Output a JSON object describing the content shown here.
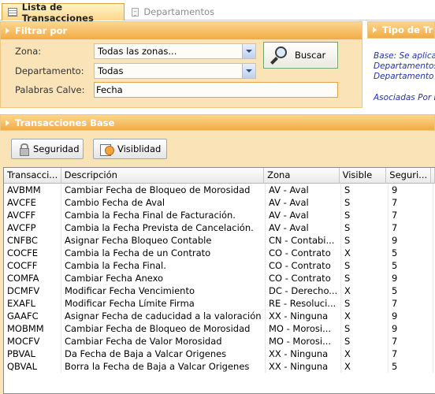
{
  "tabs": [
    {
      "label": "Lista de Transacciones",
      "active": true
    },
    {
      "label": "Departamentos",
      "active": false
    }
  ],
  "filter": {
    "title": "Filtrar por",
    "zona_label": "Zona:",
    "zona_value": "Todas las zonas...",
    "departamento_label": "Departamento:",
    "departamento_value": "Todas",
    "palabras_label": "Palabras Calve:",
    "palabras_value": "Fecha",
    "search_button": "Buscar"
  },
  "tipo": {
    "title": "Tipo de Tr",
    "lines": [
      "Base: Se aplica",
      "Departamentos",
      "Departamento \"",
      "Asociadas Por L"
    ]
  },
  "base": {
    "title": "Transacciones Base",
    "seguridad_button": "Seguridad",
    "visibilidad_button": "Visiblidad"
  },
  "grid": {
    "columns": [
      "Transacci...",
      "Descripción",
      "Zona",
      "Visible",
      "Seguri...",
      ""
    ],
    "rows": [
      [
        "AVBMM",
        "Cambiar Fecha de Bloqueo de Morosidad",
        "AV - Aval",
        "S",
        "9"
      ],
      [
        "AVCFE",
        "Cambio Fecha de Aval",
        "AV - Aval",
        "S",
        "7"
      ],
      [
        "AVCFF",
        "Cambia la Fecha Final de Facturación.",
        "AV - Aval",
        "S",
        "7"
      ],
      [
        "AVCFP",
        "Cambia la Fecha Prevista de Cancelación.",
        "AV - Aval",
        "S",
        "7"
      ],
      [
        "CNFBC",
        "Asignar Fecha Bloqueo Contable",
        "CN - Contabi...",
        "S",
        "9"
      ],
      [
        "COCFE",
        "Cambia la Fecha de un Contrato",
        "CO - Contrato",
        "X",
        "5"
      ],
      [
        "COCFF",
        "Cambia la Fecha Final.",
        "CO - Contrato",
        "S",
        "5"
      ],
      [
        "COMFA",
        "Cambiar Fecha Anexo",
        "CO - Contrato",
        "S",
        "9"
      ],
      [
        "DCMFV",
        "Modificar Fecha Vencimiento",
        "DC - Derecho...",
        "X",
        "5"
      ],
      [
        "EXAFL",
        "Modificar Fecha Límite Firma",
        "RE - Resoluci...",
        "S",
        "7"
      ],
      [
        "GAAFC",
        "Asignar Fecha de caducidad a la valoración",
        "XX - Ninguna",
        "X",
        "9"
      ],
      [
        "MOBMM",
        "Cambiar Fecha de Bloqueo de Morosidad",
        "MO - Morosi...",
        "S",
        "9"
      ],
      [
        "MOCFV",
        "Cambiar Fecha de Valor Morosidad",
        "MO - Morosi...",
        "S",
        "7"
      ],
      [
        "PBVAL",
        "Da Fecha de Baja a Valcar Origenes",
        "XX - Ninguna",
        "X",
        "7"
      ],
      [
        "QBVAL",
        "Borra la Fecha de Baja a Valcar Origenes",
        "XX - Ninguna",
        "X",
        "5"
      ]
    ]
  }
}
